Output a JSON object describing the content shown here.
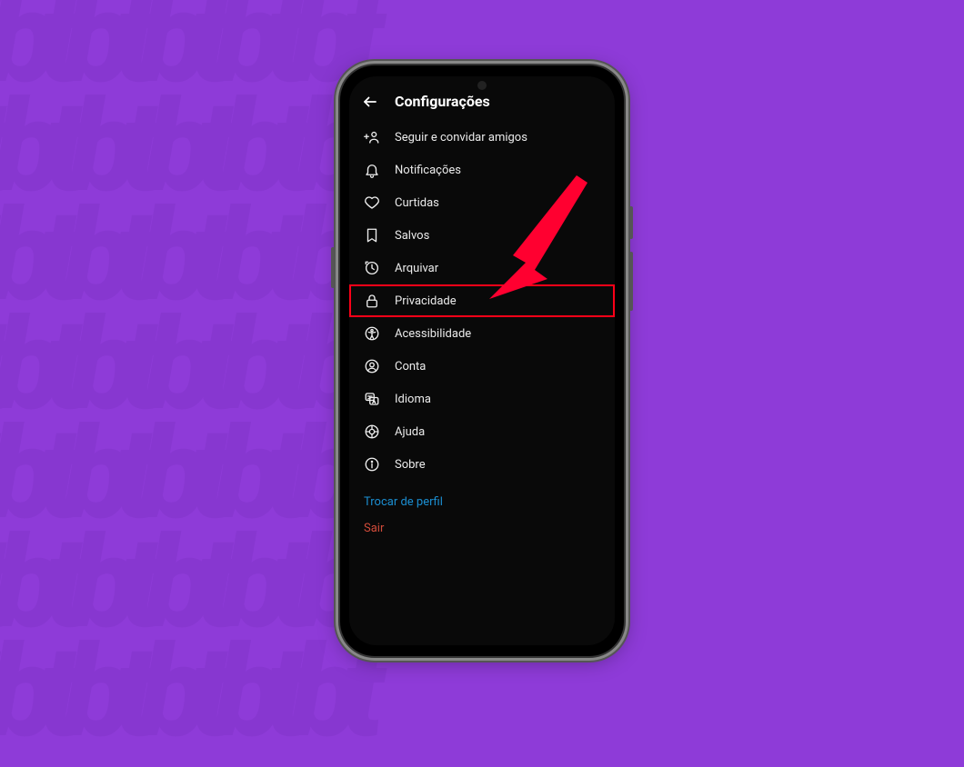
{
  "header": {
    "title": "Configurações"
  },
  "items": [
    {
      "key": "follow",
      "label": "Seguir e convidar amigos",
      "highlight": false
    },
    {
      "key": "notifications",
      "label": "Notificações",
      "highlight": false
    },
    {
      "key": "likes",
      "label": "Curtidas",
      "highlight": false
    },
    {
      "key": "saved",
      "label": "Salvos",
      "highlight": false
    },
    {
      "key": "archive",
      "label": "Arquivar",
      "highlight": false
    },
    {
      "key": "privacy",
      "label": "Privacidade",
      "highlight": true
    },
    {
      "key": "accessibility",
      "label": "Acessibilidade",
      "highlight": false
    },
    {
      "key": "account",
      "label": "Conta",
      "highlight": false
    },
    {
      "key": "language",
      "label": "Idioma",
      "highlight": false
    },
    {
      "key": "help",
      "label": "Ajuda",
      "highlight": false
    },
    {
      "key": "about",
      "label": "Sobre",
      "highlight": false
    }
  ],
  "links": {
    "switch_profile": "Trocar de perfil",
    "logout": "Sair"
  },
  "colors": {
    "background": "#8e3bd8",
    "screen_bg": "#090909",
    "highlight_border": "#ff0018",
    "arrow": "#ff0030",
    "link_blue": "#1b8ed1",
    "link_red": "#d14b3a"
  }
}
